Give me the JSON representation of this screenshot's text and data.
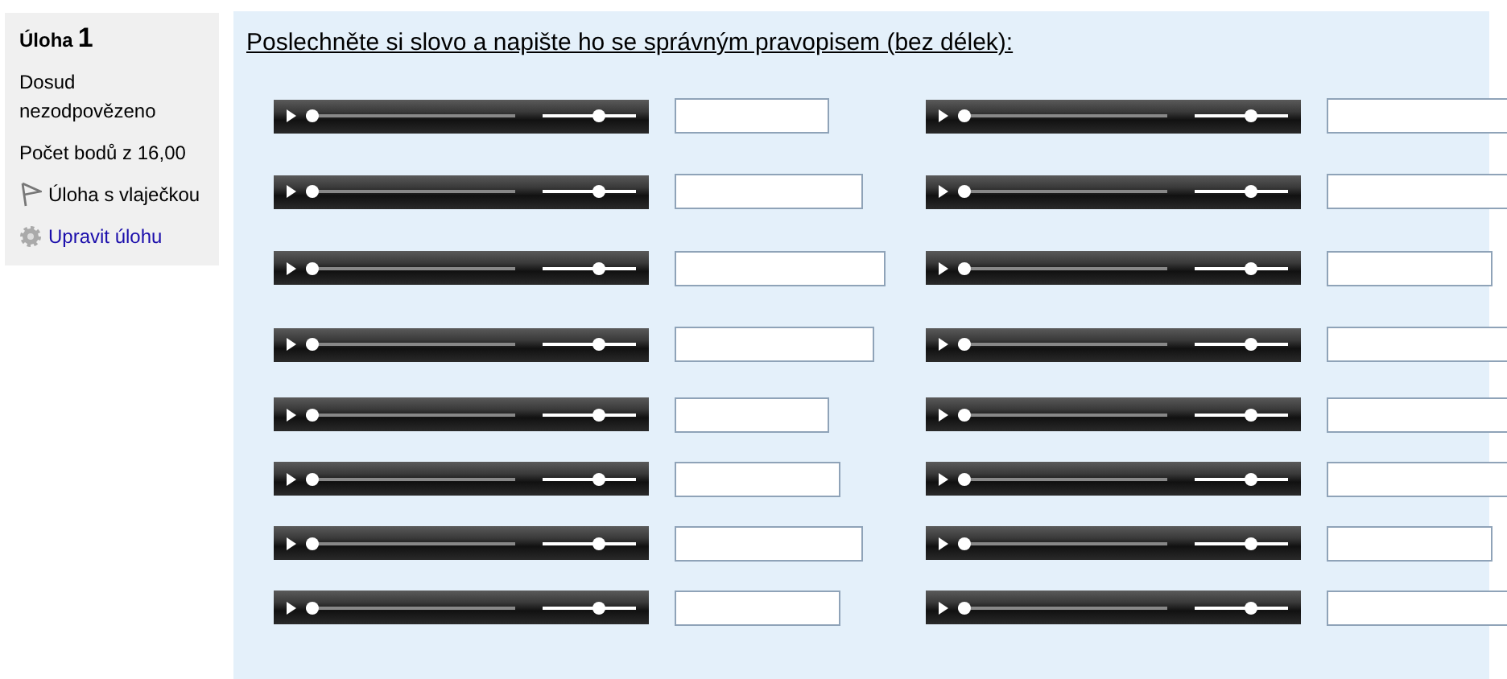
{
  "sidebar": {
    "title_word": "Úloha",
    "number": "1",
    "status": "Dosud nezodpovězeno",
    "points": "Počet bodů z 16,00",
    "flag": {
      "label": "Úloha s vlaječkou",
      "flagged": false
    },
    "edit_link": "Upravit úlohu"
  },
  "question": {
    "prompt": "Poslechněte si slovo a napište ho se správným pravopisem (bez délek):",
    "items": [
      {
        "seek": {
          "level": 0
        },
        "volume": {
          "level": 0.6
        }
      },
      {
        "seek": {
          "level": 0
        },
        "volume": {
          "level": 0.6
        }
      },
      {
        "seek": {
          "level": 0
        },
        "volume": {
          "level": 0.6
        }
      },
      {
        "seek": {
          "level": 0
        },
        "volume": {
          "level": 0.6
        }
      },
      {
        "seek": {
          "level": 0
        },
        "volume": {
          "level": 0.6
        }
      },
      {
        "seek": {
          "level": 0
        },
        "volume": {
          "level": 0.6
        }
      },
      {
        "seek": {
          "level": 0
        },
        "volume": {
          "level": 0.6
        }
      },
      {
        "seek": {
          "level": 0
        },
        "volume": {
          "level": 0.6
        }
      },
      {
        "seek": {
          "level": 0
        },
        "volume": {
          "level": 0.6
        }
      },
      {
        "seek": {
          "level": 0
        },
        "volume": {
          "level": 0.6
        }
      },
      {
        "seek": {
          "level": 0
        },
        "volume": {
          "level": 0.6
        }
      },
      {
        "seek": {
          "level": 0
        },
        "volume": {
          "level": 0.6
        }
      },
      {
        "seek": {
          "level": 0
        },
        "volume": {
          "level": 0.6
        }
      },
      {
        "seek": {
          "level": 0
        },
        "volume": {
          "level": 0.6
        }
      },
      {
        "seek": {
          "level": 0
        },
        "volume": {
          "level": 0.6
        }
      },
      {
        "seek": {
          "level": 0
        },
        "volume": {
          "level": 0.6
        }
      }
    ]
  }
}
